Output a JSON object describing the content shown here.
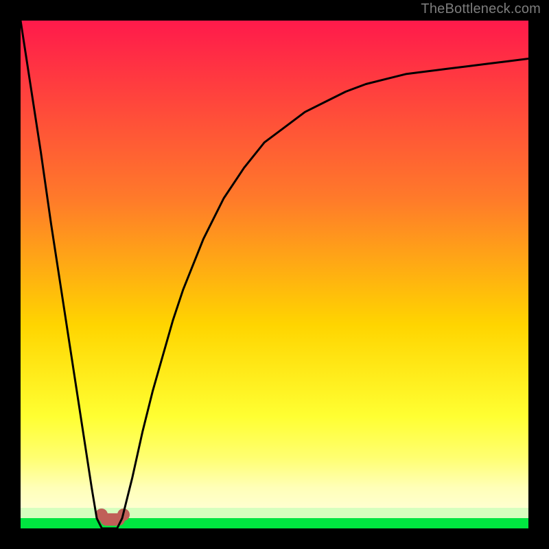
{
  "attribution": "TheBottleneck.com",
  "chart_data": {
    "type": "line",
    "title": "",
    "xlabel": "",
    "ylabel": "",
    "xlim": [
      0,
      100
    ],
    "ylim": [
      0,
      100
    ],
    "grid": false,
    "series": [
      {
        "name": "curve",
        "x": [
          0,
          2,
          4,
          6,
          8,
          10,
          12,
          14,
          15,
          16,
          17,
          18,
          19,
          20,
          21,
          22,
          24,
          26,
          28,
          30,
          32,
          34,
          36,
          38,
          40,
          44,
          48,
          52,
          56,
          60,
          64,
          68,
          72,
          76,
          80,
          84,
          88,
          92,
          96,
          100
        ],
        "values": [
          100,
          87,
          74,
          60,
          47,
          34,
          21,
          8,
          2,
          0,
          0,
          0,
          0,
          2,
          6,
          10,
          19,
          27,
          34,
          41,
          47,
          52,
          57,
          61,
          65,
          71,
          76,
          79,
          82,
          84,
          86,
          87.5,
          88.5,
          89.5,
          90,
          90.5,
          91,
          91.5,
          92,
          92.5
        ]
      }
    ],
    "highlight_range_x": [
      15,
      19
    ],
    "background": {
      "gradient_top": "#ff1a4b",
      "gradient_mid": "#ffd500",
      "gradient_yellow": "#ffff55",
      "gradient_pale": "#ffffc8",
      "band_green": "#00e640"
    },
    "frame_color": "#000000",
    "marker_color": "#c06058"
  }
}
